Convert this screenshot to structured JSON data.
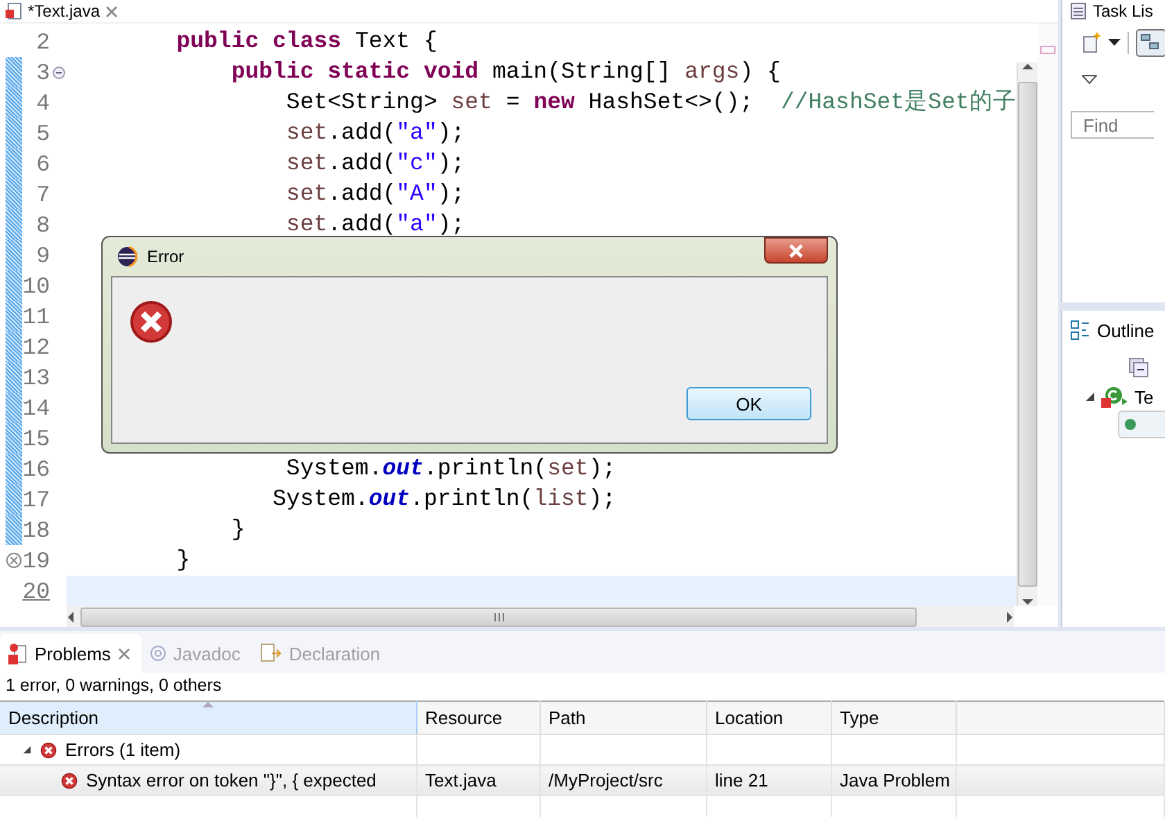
{
  "editor": {
    "tab": {
      "title": "*Text.java"
    },
    "lines": [
      {
        "number": "2",
        "changed": false,
        "current": false,
        "foldable": false,
        "error": false,
        "segments": [
          {
            "kind": "keyword",
            "text": "        public class"
          },
          {
            "kind": "plain",
            "text": " Text {"
          }
        ]
      },
      {
        "number": "3",
        "changed": true,
        "current": false,
        "foldable": true,
        "error": false,
        "segments": [
          {
            "kind": "keyword",
            "text": "            public static void"
          },
          {
            "kind": "plain",
            "text": " main(String[] "
          },
          {
            "kind": "variable",
            "text": "args"
          },
          {
            "kind": "plain",
            "text": ") {"
          }
        ]
      },
      {
        "number": "4",
        "changed": true,
        "current": false,
        "foldable": false,
        "error": false,
        "segments": [
          {
            "kind": "plain",
            "text": "                Set<String> "
          },
          {
            "kind": "variable",
            "text": "set"
          },
          {
            "kind": "plain",
            "text": " = "
          },
          {
            "kind": "keyword",
            "text": "new"
          },
          {
            "kind": "plain",
            "text": " HashSet<>();  "
          },
          {
            "kind": "comment",
            "text": "//HashSet是Set的子"
          }
        ]
      },
      {
        "number": "5",
        "changed": true,
        "current": false,
        "foldable": false,
        "error": false,
        "segments": [
          {
            "kind": "variable",
            "text": "                set"
          },
          {
            "kind": "plain",
            "text": ".add("
          },
          {
            "kind": "string",
            "text": "\"a\""
          },
          {
            "kind": "plain",
            "text": ");"
          }
        ]
      },
      {
        "number": "6",
        "changed": true,
        "current": false,
        "foldable": false,
        "error": false,
        "segments": [
          {
            "kind": "variable",
            "text": "                set"
          },
          {
            "kind": "plain",
            "text": ".add("
          },
          {
            "kind": "string",
            "text": "\"c\""
          },
          {
            "kind": "plain",
            "text": ");"
          }
        ]
      },
      {
        "number": "7",
        "changed": true,
        "current": false,
        "foldable": false,
        "error": false,
        "segments": [
          {
            "kind": "variable",
            "text": "                set"
          },
          {
            "kind": "plain",
            "text": ".add("
          },
          {
            "kind": "string",
            "text": "\"A\""
          },
          {
            "kind": "plain",
            "text": ");"
          }
        ]
      },
      {
        "number": "8",
        "changed": true,
        "current": false,
        "foldable": false,
        "error": false,
        "segments": [
          {
            "kind": "variable",
            "text": "                set"
          },
          {
            "kind": "plain",
            "text": ".add("
          },
          {
            "kind": "string",
            "text": "\"a\""
          },
          {
            "kind": "plain",
            "text": ");"
          }
        ]
      },
      {
        "number": "9",
        "changed": true,
        "current": false,
        "foldable": false,
        "error": false
      },
      {
        "number": "10",
        "changed": true,
        "current": false,
        "foldable": false,
        "error": false
      },
      {
        "number": "11",
        "changed": true,
        "current": false,
        "foldable": false,
        "error": false
      },
      {
        "number": "12",
        "changed": true,
        "current": false,
        "foldable": false,
        "error": false
      },
      {
        "number": "13",
        "changed": true,
        "current": false,
        "foldable": false,
        "error": false
      },
      {
        "number": "14",
        "changed": true,
        "current": false,
        "foldable": false,
        "error": false
      },
      {
        "number": "15",
        "changed": true,
        "current": false,
        "foldable": false,
        "error": false
      },
      {
        "number": "16",
        "changed": true,
        "current": false,
        "foldable": false,
        "error": false,
        "segments": [
          {
            "kind": "plain",
            "text": "                System."
          },
          {
            "kind": "static_field",
            "text": "out"
          },
          {
            "kind": "plain",
            "text": ".println("
          },
          {
            "kind": "variable",
            "text": "set"
          },
          {
            "kind": "plain",
            "text": ");"
          }
        ]
      },
      {
        "number": "17",
        "changed": true,
        "current": false,
        "foldable": false,
        "error": false,
        "segments": [
          {
            "kind": "plain",
            "text": "               System."
          },
          {
            "kind": "static_field",
            "text": "out"
          },
          {
            "kind": "plain",
            "text": ".println("
          },
          {
            "kind": "variable",
            "text": "list"
          },
          {
            "kind": "plain",
            "text": ");"
          }
        ]
      },
      {
        "number": "18",
        "changed": true,
        "current": false,
        "foldable": false,
        "error": false,
        "segments": [
          {
            "kind": "plain",
            "text": "            }"
          }
        ]
      },
      {
        "number": "19",
        "changed": false,
        "current": false,
        "foldable": false,
        "error": true,
        "segments": [
          {
            "kind": "plain",
            "text": "        }"
          }
        ]
      },
      {
        "number": "20",
        "changed": false,
        "current": true,
        "foldable": false,
        "error": false
      }
    ]
  },
  "dialog": {
    "title": "Error",
    "buttons": [
      "OK"
    ]
  },
  "task_list": {
    "title": "Task Lis",
    "find": {
      "placeholder": "Find"
    }
  },
  "outline": {
    "title": "Outline",
    "tree": [
      {
        "label": "Te",
        "expanded": true,
        "children": [
          {
            "selected": true
          }
        ]
      }
    ]
  },
  "problems": {
    "tabs": [
      {
        "label": "Problems",
        "selected": true
      },
      {
        "label": "Javadoc",
        "selected": false
      },
      {
        "label": "Declaration",
        "selected": false
      }
    ],
    "summary": "1 error, 0 warnings, 0 others",
    "columns": [
      {
        "label": "Description",
        "sorted": true
      },
      {
        "label": "Resource",
        "sorted": false
      },
      {
        "label": "Path",
        "sorted": false
      },
      {
        "label": "Location",
        "sorted": false
      },
      {
        "label": "Type",
        "sorted": false
      }
    ],
    "groups": [
      {
        "label": "Errors (1 item)",
        "expanded": true,
        "children": [
          {
            "cells": [
              "Syntax error on token \"}\", { expected",
              "Text.java",
              "/MyProject/src",
              "line 21",
              "Java Problem"
            ]
          }
        ]
      }
    ]
  }
}
